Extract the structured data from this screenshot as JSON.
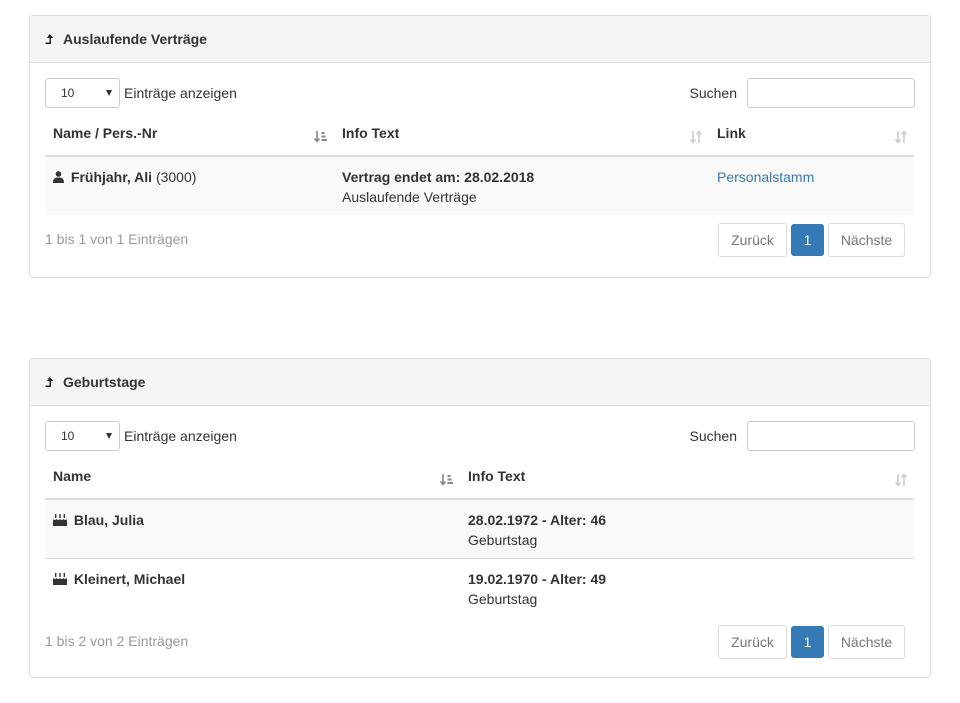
{
  "colors": {
    "accent": "#337ab7",
    "border": "#dddddd",
    "heading_bg": "#f5f5f5",
    "muted": "#999999"
  },
  "contracts": {
    "title": "Auslaufende Verträge",
    "title_icon": "arrow-up-icon",
    "length_value": "10",
    "length_label": "Einträge anzeigen",
    "search_label": "Suchen",
    "search_value": "",
    "columns": [
      "Name / Pers.-Nr",
      "Info Text",
      "Link"
    ],
    "rows": [
      {
        "icon": "user-icon",
        "name": "Frühjahr, Ali",
        "pers_nr": "(3000)",
        "info_title": "Vertrag endet am: 28.02.2018",
        "info_sub": "Auslaufende Verträge",
        "link": "Personalstamm"
      }
    ],
    "info": "1 bis 1 von 1 Einträgen",
    "prev": "Zurück",
    "page": "1",
    "next": "Nächste"
  },
  "birthdays": {
    "title": "Geburtstage",
    "title_icon": "arrow-up-icon",
    "length_value": "10",
    "length_label": "Einträge anzeigen",
    "search_label": "Suchen",
    "search_value": "",
    "columns": [
      "Name",
      "Info Text"
    ],
    "rows": [
      {
        "icon": "cake-icon",
        "name": "Blau, Julia",
        "info_title": "28.02.1972 - Alter: 46",
        "info_sub": "Geburtstag"
      },
      {
        "icon": "cake-icon",
        "name": "Kleinert, Michael",
        "info_title": "19.02.1970 - Alter: 49",
        "info_sub": "Geburtstag"
      }
    ],
    "info": "1 bis 2 von 2 Einträgen",
    "prev": "Zurück",
    "page": "1",
    "next": "Nächste"
  }
}
